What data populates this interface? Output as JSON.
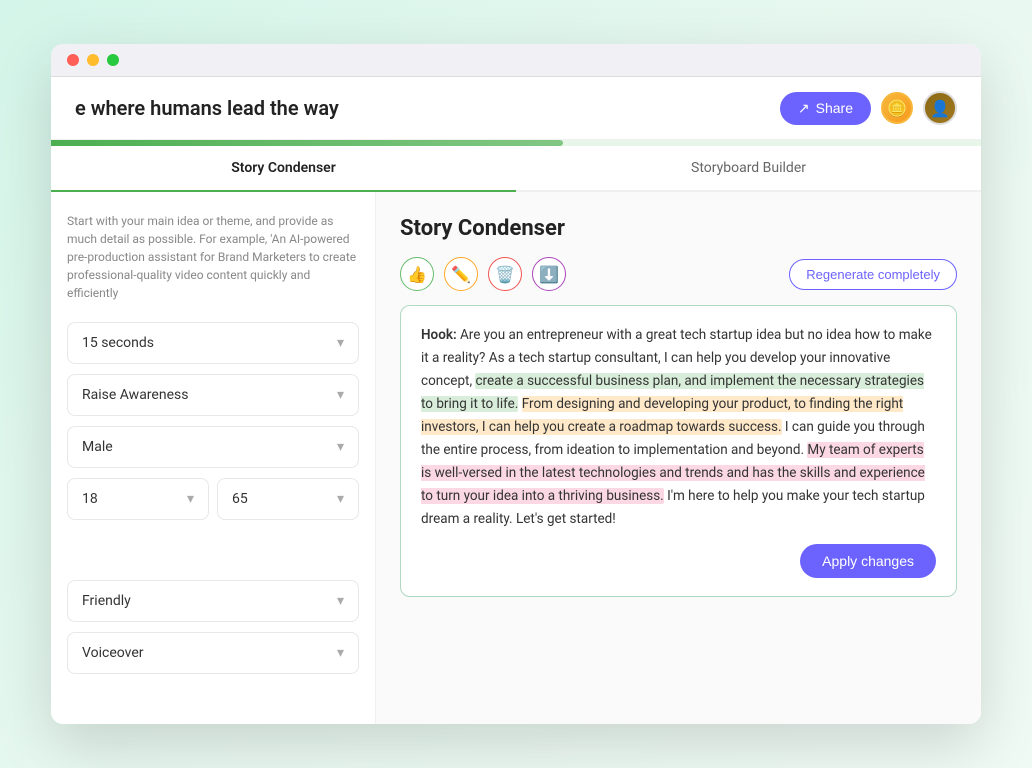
{
  "header": {
    "title": "e where humans lead the way",
    "share_label": "Share",
    "share_icon": "↗"
  },
  "tabs": [
    {
      "id": "story-condenser",
      "label": "Story Condenser",
      "active": true
    },
    {
      "id": "storyboard-builder",
      "label": "Storyboard Builder",
      "active": false
    }
  ],
  "sidebar": {
    "description": "Start with your main idea or theme, and provide as much detail as possible. For example, 'An AI-powered pre-production assistant for Brand Marketers to create professional-quality video content quickly and efficiently",
    "fields": [
      {
        "id": "duration",
        "label": "15 seconds"
      },
      {
        "id": "goal",
        "label": "Raise Awareness"
      },
      {
        "id": "gender",
        "label": "Male"
      },
      {
        "id": "age-min",
        "label": "18"
      },
      {
        "id": "age-max",
        "label": "65"
      },
      {
        "id": "tone",
        "label": "Friendly"
      },
      {
        "id": "voiceover",
        "label": "Voiceover"
      }
    ]
  },
  "story_condenser": {
    "title": "Story Condenser",
    "toolbar": {
      "like_icon": "👍",
      "edit_icon": "✏️",
      "delete_icon": "🗑️",
      "download_icon": "⬇️",
      "regenerate_label": "Regenerate completely",
      "apply_label": "Apply changes"
    },
    "content": {
      "hook_prefix": "Hook: ",
      "text_segments": [
        {
          "text": "Are you an entrepreneur with a great tech startup idea but no idea how to make it a reality? As a tech startup consultant, I can help you develop your innovative concept, ",
          "highlight": "none"
        },
        {
          "text": "create a successful business plan, and implement the necessary strategies to bring it to life.",
          "highlight": "green"
        },
        {
          "text": " ",
          "highlight": "none"
        },
        {
          "text": "From designing and developing your product, to finding the right investors, I can help you create a roadmap towards success.",
          "highlight": "orange"
        },
        {
          "text": " I can guide you through the entire process, from ideation to implementation and beyond. ",
          "highlight": "none"
        },
        {
          "text": "My team of experts is well-versed in the latest technologies and trends and has the skills and experience to turn your idea into a thriving business.",
          "highlight": "pink"
        },
        {
          "text": " I'm here to help you make your tech startup dream a reality. Let's get started!",
          "highlight": "none"
        }
      ]
    }
  },
  "progress": {
    "percent": 55
  }
}
